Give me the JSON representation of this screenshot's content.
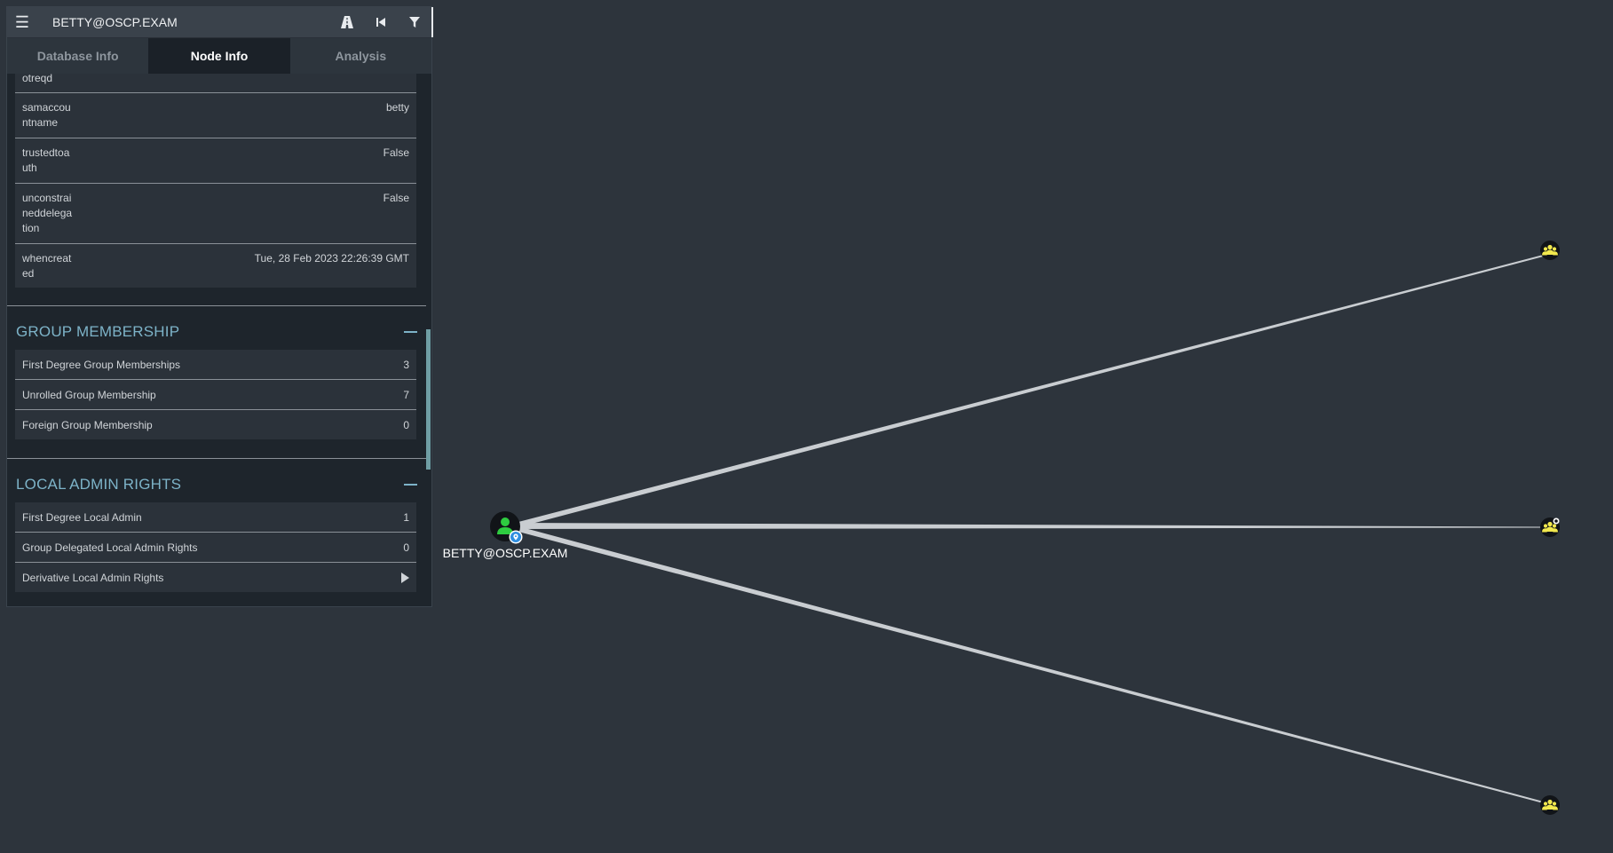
{
  "search": {
    "value": "BETTY@OSCP.EXAM"
  },
  "tabs": [
    {
      "label": "Database Info"
    },
    {
      "label": "Node Info"
    },
    {
      "label": "Analysis"
    }
  ],
  "properties": [
    {
      "key": "otreqd",
      "value": ""
    },
    {
      "key": "samaccou\nntname",
      "value": "betty"
    },
    {
      "key": "trustedtoa\nuth",
      "value": "False"
    },
    {
      "key": "unconstrai\nneddelega\ntion",
      "value": "False"
    },
    {
      "key": "whencreat\ned",
      "value": "Tue, 28 Feb 2023 22:26:39 GMT"
    }
  ],
  "group_membership": {
    "title": "GROUP MEMBERSHIP",
    "rows": [
      {
        "label": "First Degree Group Memberships",
        "value": "3"
      },
      {
        "label": "Unrolled Group Membership",
        "value": "7"
      },
      {
        "label": "Foreign Group Membership",
        "value": "0"
      }
    ]
  },
  "local_admin": {
    "title": "LOCAL ADMIN RIGHTS",
    "rows": [
      {
        "label": "First Degree Local Admin",
        "value": "1"
      },
      {
        "label": "Group Delegated Local Admin Rights",
        "value": "0"
      },
      {
        "label": "Derivative Local Admin Rights",
        "value": ""
      }
    ]
  },
  "graph": {
    "center_node": {
      "label": "BETTY@OSCP.EXAM",
      "icon": "user-icon",
      "color": "#2ecc40"
    },
    "group_nodes": [
      {
        "icon": "group-icon",
        "color": "#f2e94e"
      },
      {
        "icon": "group-icon",
        "color": "#f2e94e"
      },
      {
        "icon": "group-icon",
        "color": "#f2e94e"
      }
    ],
    "background": "#2d343c"
  }
}
